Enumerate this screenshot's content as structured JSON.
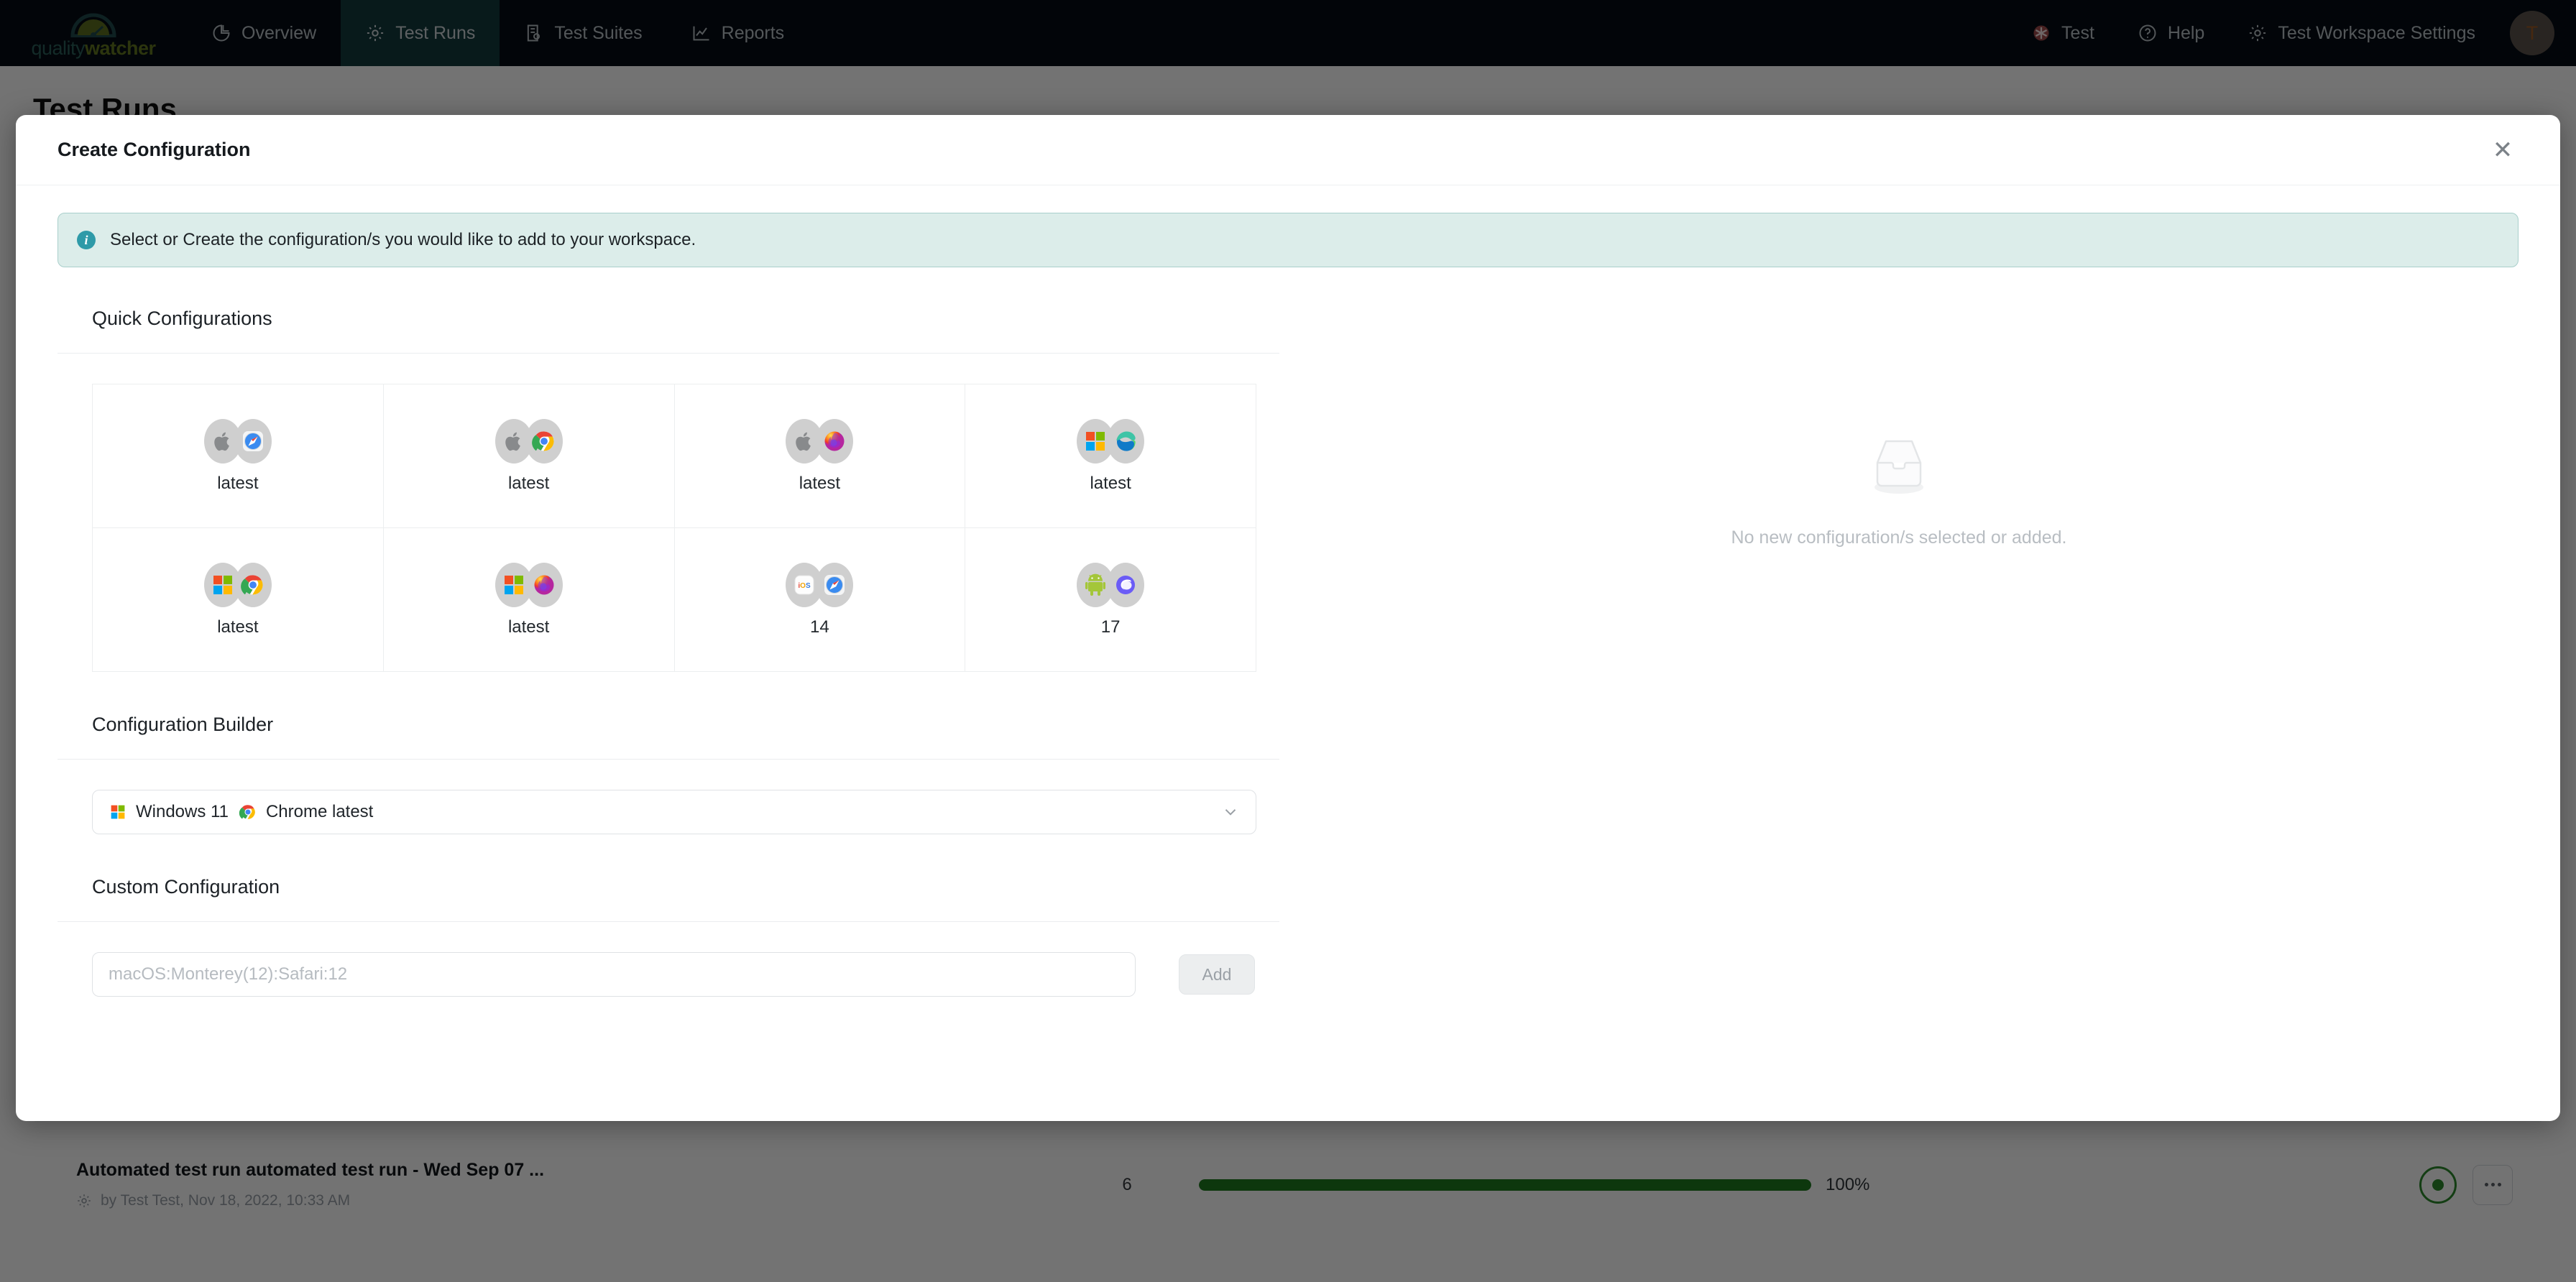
{
  "navbar": {
    "logo_quality": "quality",
    "logo_watcher": "watcher",
    "items": [
      {
        "label": "Overview",
        "icon": "pie-chart-icon",
        "active": false
      },
      {
        "label": "Test Runs",
        "icon": "gear-icon",
        "active": true
      },
      {
        "label": "Test Suites",
        "icon": "list-doc-icon",
        "active": false
      },
      {
        "label": "Reports",
        "icon": "line-chart-icon",
        "active": false
      }
    ],
    "right_items": [
      {
        "label": "Test",
        "icon": "asterisk-badge-icon"
      },
      {
        "label": "Help",
        "icon": "question-circle-icon"
      },
      {
        "label": "Test Workspace Settings",
        "icon": "gear-icon"
      }
    ],
    "avatar_initial": "T"
  },
  "page": {
    "heading": "Test Runs"
  },
  "modal": {
    "title": "Create Configuration",
    "close_label": "✕",
    "info_banner": {
      "icon": "info-icon",
      "text": "Select or Create the configuration/s you would like to add to your workspace."
    },
    "quick_configurations": {
      "title": "Quick Configurations",
      "cards": [
        {
          "os": "apple",
          "browser": "safari",
          "label": "latest"
        },
        {
          "os": "apple",
          "browser": "chrome",
          "label": "latest"
        },
        {
          "os": "apple",
          "browser": "firefox",
          "label": "latest"
        },
        {
          "os": "windows",
          "browser": "edge",
          "label": "latest"
        },
        {
          "os": "windows",
          "browser": "chrome",
          "label": "latest"
        },
        {
          "os": "windows",
          "browser": "firefox",
          "label": "latest"
        },
        {
          "os": "ios",
          "browser": "safari",
          "label": "14"
        },
        {
          "os": "android",
          "browser": "samsung",
          "label": "17"
        }
      ]
    },
    "configuration_builder": {
      "title": "Configuration Builder",
      "selected_value": "Windows 11 Chrome latest",
      "selected_os": "windows",
      "selected_browser": "chrome",
      "chevron": "chevron-down-icon"
    },
    "custom_configuration": {
      "title": "Custom Configuration",
      "input_placeholder": "macOS:Monterey(12):Safari:12",
      "input_value": "",
      "add_label": "Add"
    },
    "empty_panel": {
      "icon": "empty-inbox-icon",
      "text": "No new configuration/s selected or added."
    }
  },
  "test_run": {
    "title": "Automated test run automated test run - Wed Sep 07 ...",
    "meta": "by Test Test, Nov 18, 2022, 10:33 AM",
    "meta_icon": "gear-icon",
    "count": "6",
    "progress_percent": 100,
    "progress_label": "100%",
    "progress_color": "#1e7a1e",
    "run_button": "run-button",
    "more_button": "more-options-button"
  }
}
